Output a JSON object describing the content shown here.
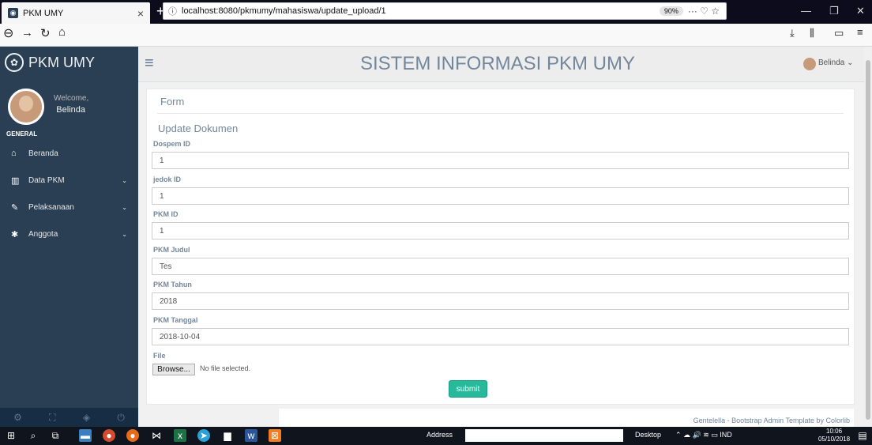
{
  "browser": {
    "tab_title": "PKM UMY",
    "tab_close": "×",
    "new_tab": "+",
    "url": "localhost:8080/pkmumy/mahasiswa/update_upload/1",
    "zoom": "90%",
    "page_actions": "··· ♡ ☆"
  },
  "sidebar": {
    "brand": "PKM UMY",
    "welcome": "Welcome,",
    "user_name": "Belinda",
    "section": "GENERAL",
    "items": [
      {
        "label": "Beranda",
        "icon": "home-icon",
        "glyph": "⌂",
        "has_submenu": false
      },
      {
        "label": "Data PKM",
        "icon": "bar-chart-icon",
        "glyph": "▥",
        "has_submenu": true
      },
      {
        "label": "Pelaksanaan",
        "icon": "edit-icon",
        "glyph": "✎",
        "has_submenu": true
      },
      {
        "label": "Anggota",
        "icon": "bug-icon",
        "glyph": "✱",
        "has_submenu": true
      }
    ]
  },
  "header": {
    "title": "SISTEM INFORMASI PKM UMY",
    "user": "Belinda ⌄"
  },
  "panel": {
    "title": "Form",
    "subtitle": "Update Dokumen",
    "fields": [
      {
        "label": "Dospem ID",
        "value": "1"
      },
      {
        "label": "jedok ID",
        "value": "1"
      },
      {
        "label": "PKM ID",
        "value": "1"
      },
      {
        "label": "PKM Judul",
        "value": "Tes"
      },
      {
        "label": "PKM Tahun",
        "value": "2018"
      },
      {
        "label": "PKM Tanggal",
        "value": "2018-10-04"
      }
    ],
    "file_label": "File",
    "browse_label": "Browse...",
    "no_file": "No file selected.",
    "submit_label": "submit"
  },
  "footer": {
    "text": "Gentelella - Bootstrap Admin Template by Colorlib"
  },
  "taskbar": {
    "address_label": "Address",
    "desktop_label": "Desktop",
    "language": "IND",
    "time": "10:06",
    "date": "05/10/2018"
  },
  "colors": {
    "sidebar": "#2a3f54",
    "submit": "#26b99a",
    "text": "#73879c"
  }
}
